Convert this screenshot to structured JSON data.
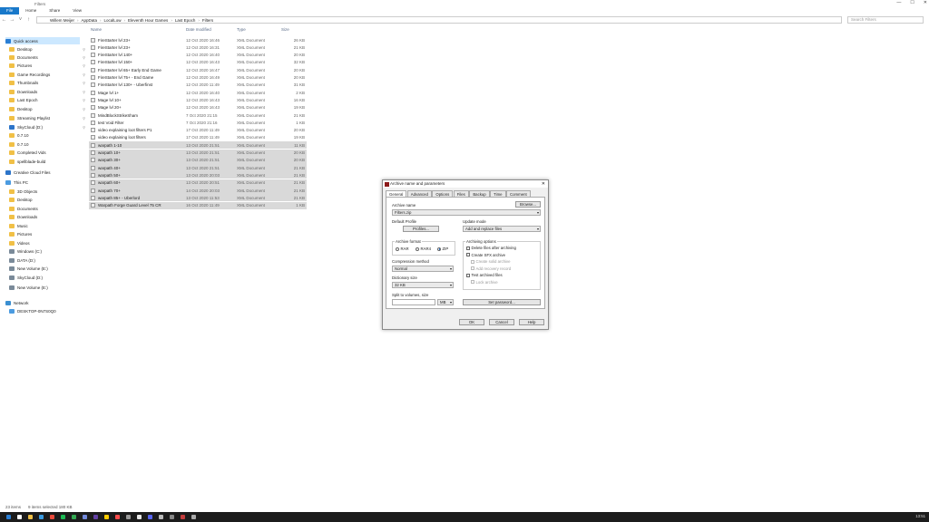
{
  "window": {
    "title": "Filters",
    "controls": [
      "—",
      "☐",
      "✕"
    ]
  },
  "ribbon": {
    "tabs": [
      "File",
      "Home",
      "Share",
      "View"
    ]
  },
  "address": {
    "crumbs": [
      "Willem Meijer",
      "AppData",
      "LocalLow",
      "Eleventh Hour Games",
      "Last Epoch",
      "Filters"
    ],
    "search_placeholder": "Search Filters"
  },
  "sidebar": {
    "items": [
      {
        "label": "Quick access",
        "icon": "star-icon",
        "pinned": false
      },
      {
        "label": "Desktop",
        "icon": "folder-icon",
        "pinned": true
      },
      {
        "label": "Documents",
        "icon": "folder-icon",
        "pinned": true
      },
      {
        "label": "Pictures",
        "icon": "folder-icon",
        "pinned": true
      },
      {
        "label": "Game Recordings",
        "icon": "folder-icon",
        "pinned": true
      },
      {
        "label": "Thumbnails",
        "icon": "folder-icon",
        "pinned": true
      },
      {
        "label": "Downloads",
        "icon": "folder-icon",
        "pinned": true
      },
      {
        "label": "Last Epoch",
        "icon": "folder-icon",
        "pinned": true
      },
      {
        "label": "Desktop",
        "icon": "folder-icon",
        "pinned": true
      },
      {
        "label": "Streaming Playlist",
        "icon": "folder-icon",
        "pinned": true
      },
      {
        "label": "SkyCloud (D:)",
        "icon": "cloud-icon",
        "pinned": true
      },
      {
        "label": "0.7.10",
        "icon": "folder-icon",
        "pinned": false
      },
      {
        "label": "0.7.10",
        "icon": "folder-icon",
        "pinned": false
      },
      {
        "label": "Completed Vids",
        "icon": "folder-icon",
        "pinned": false
      },
      {
        "label": "spellblade-build",
        "icon": "folder-icon",
        "pinned": false
      },
      {
        "label": "Creative Cloud Files",
        "icon": "cloud-icon",
        "pinned": false
      },
      {
        "label": "This PC",
        "icon": "pc-icon",
        "pinned": false
      },
      {
        "label": "3D Objects",
        "icon": "folder-icon",
        "pinned": false
      },
      {
        "label": "Desktop",
        "icon": "folder-icon",
        "pinned": false
      },
      {
        "label": "Documents",
        "icon": "folder-icon",
        "pinned": false
      },
      {
        "label": "Downloads",
        "icon": "folder-icon",
        "pinned": false
      },
      {
        "label": "Music",
        "icon": "folder-icon",
        "pinned": false
      },
      {
        "label": "Pictures",
        "icon": "folder-icon",
        "pinned": false
      },
      {
        "label": "Videos",
        "icon": "folder-icon",
        "pinned": false
      },
      {
        "label": "Windows (C:)",
        "icon": "drive-icon",
        "pinned": false
      },
      {
        "label": "DATA (D:)",
        "icon": "drive-icon",
        "pinned": false
      },
      {
        "label": "New Volume (E:)",
        "icon": "drive-icon",
        "pinned": false
      },
      {
        "label": "SkyCloud (D:)",
        "icon": "drive-icon",
        "pinned": false
      },
      {
        "label": "New Volume (E:)",
        "icon": "drive-icon",
        "pinned": false
      },
      {
        "label": "Network",
        "icon": "network-icon",
        "pinned": false
      },
      {
        "label": "DESKTOP-0N7S0Q0",
        "icon": "pc-icon",
        "pinned": false
      }
    ]
  },
  "columns": {
    "name": "Name",
    "date": "Date modified",
    "type": "Type",
    "size": "Size"
  },
  "files": [
    {
      "name": "FireStarter lvl 23+",
      "date": "12 Oct 2020 16:46",
      "type": "XML Document",
      "size": "26 KB",
      "selected": false
    },
    {
      "name": "FireStarter lvl 23+",
      "date": "12 Oct 2020 16:31",
      "type": "XML Document",
      "size": "21 KB",
      "selected": false
    },
    {
      "name": "FireStarter lvl 140+",
      "date": "12 Oct 2020 16:40",
      "type": "XML Document",
      "size": "20 KB",
      "selected": false
    },
    {
      "name": "FireStarter lvl 150+",
      "date": "12 Oct 2020 16:43",
      "type": "XML Document",
      "size": "32 KB",
      "selected": false
    },
    {
      "name": "FireStarter lvl 65+ Early End Game",
      "date": "12 Oct 2020 16:47",
      "type": "XML Document",
      "size": "20 KB",
      "selected": false
    },
    {
      "name": "FireStarter lvl 75+ - End Game",
      "date": "12 Oct 2020 16:49",
      "type": "XML Document",
      "size": "20 KB",
      "selected": false
    },
    {
      "name": "FireStarter lvl 130+ - Uberfinst",
      "date": "12 Oct 2020 11:49",
      "type": "XML Document",
      "size": "31 KB",
      "selected": false
    },
    {
      "name": "Mage lvl 1+",
      "date": "12 Oct 2020 16:40",
      "type": "XML Document",
      "size": "2 KB",
      "selected": false
    },
    {
      "name": "Mage lvl 10+",
      "date": "12 Oct 2020 16:43",
      "type": "XML Document",
      "size": "16 KB",
      "selected": false
    },
    {
      "name": "Mage lvl 20+",
      "date": "12 Oct 2020 16:43",
      "type": "XML Document",
      "size": "19 KB",
      "selected": false
    },
    {
      "name": "MindBlockStrikeSham",
      "date": "7 Oct 2020 21:15",
      "type": "XML Document",
      "size": "21 KB",
      "selected": false
    },
    {
      "name": "test Void Filter",
      "date": "7 Oct 2020 21:16",
      "type": "XML Document",
      "size": "1 KB",
      "selected": false
    },
    {
      "name": "video explaining loot filters P1",
      "date": "17 Oct 2020 11:49",
      "type": "XML Document",
      "size": "20 KB",
      "selected": false
    },
    {
      "name": "video explaining loot filters",
      "date": "17 Oct 2020 11:49",
      "type": "XML Document",
      "size": "19 KB",
      "selected": false
    },
    {
      "name": "warpath 1-10",
      "date": "13 Oct 2020 21:51",
      "type": "XML Document",
      "size": "11 KB",
      "selected": true
    },
    {
      "name": "warpath 10+",
      "date": "13 Oct 2020 21:51",
      "type": "XML Document",
      "size": "20 KB",
      "selected": true
    },
    {
      "name": "warpath 30+",
      "date": "13 Oct 2020 21:51",
      "type": "XML Document",
      "size": "20 KB",
      "selected": true
    },
    {
      "name": "warpath 40+",
      "date": "13 Oct 2020 21:51",
      "type": "XML Document",
      "size": "21 KB",
      "selected": true
    },
    {
      "name": "warpath 50+",
      "date": "13 Oct 2020 20:03",
      "type": "XML Document",
      "size": "21 KB",
      "selected": true
    },
    {
      "name": "warpath 60+",
      "date": "13 Oct 2020 20:51",
      "type": "XML Document",
      "size": "21 KB",
      "selected": true
    },
    {
      "name": "warpath 70+",
      "date": "14 Oct 2020 20:03",
      "type": "XML Document",
      "size": "21 KB",
      "selected": true
    },
    {
      "name": "warpath 85+ - Uberlord",
      "date": "13 Oct 2020 11:53",
      "type": "XML Document",
      "size": "21 KB",
      "selected": true
    },
    {
      "name": "Warpath Forge Guard Level 75 CR",
      "date": "16 Oct 2020 11:49",
      "type": "XML Document",
      "size": "1 KB",
      "selected": true
    }
  ],
  "status": {
    "count": "23 items",
    "selection": "9 items selected 180 KB"
  },
  "dialog": {
    "title": "Archive name and parameters",
    "tabs": [
      "General",
      "Advanced",
      "Options",
      "Files",
      "Backup",
      "Time",
      "Comment"
    ],
    "archive_name_label": "Archive name",
    "archive_name_value": "Filters.zip",
    "browse_label": "Browse...",
    "default_profile_label": "Default Profile",
    "profiles_label": "Profiles...",
    "update_mode_label": "Update mode",
    "update_mode_value": "Add and replace files",
    "archive_format_label": "Archive format",
    "formats": [
      "RAR",
      "RAR4",
      "ZIP"
    ],
    "selected_format": "ZIP",
    "archiving_options_label": "Archiving options",
    "options": [
      {
        "label": "Delete files after archiving",
        "enabled": true
      },
      {
        "label": "Create SFX archive",
        "enabled": true
      },
      {
        "label": "Create solid archive",
        "enabled": false
      },
      {
        "label": "Add recovery record",
        "enabled": false
      },
      {
        "label": "Test archived files",
        "enabled": true
      },
      {
        "label": "Lock archive",
        "enabled": false
      }
    ],
    "compression_label": "Compression method",
    "compression_value": "Normal",
    "dictionary_label": "Dictionary size",
    "dictionary_value": "32 KB",
    "split_label": "Split to volumes, size",
    "split_unit": "MB",
    "set_password_label": "Set password...",
    "ok_label": "OK",
    "cancel_label": "Cancel",
    "help_label": "Help"
  },
  "taskbar": {
    "clock": "13:51"
  },
  "colors": {
    "accent": "#1979ca",
    "selection": "#d9d9d9",
    "winrar": "#8b1a1a"
  }
}
